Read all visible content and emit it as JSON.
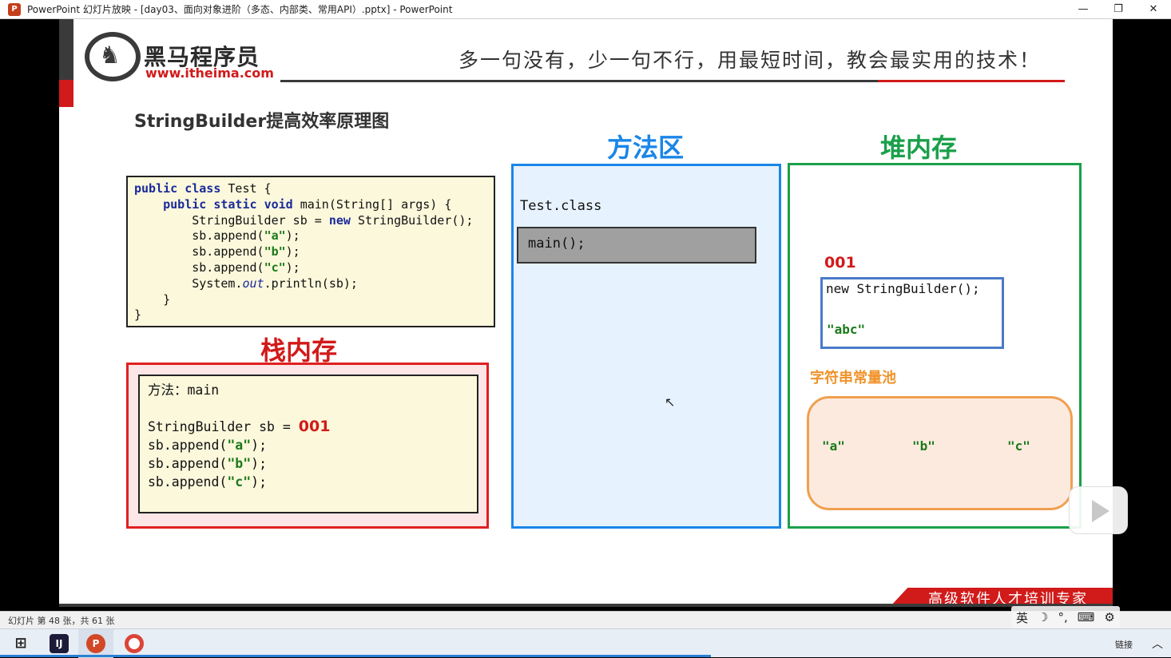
{
  "window": {
    "title": "PowerPoint 幻灯片放映 - [day03、面向对象进阶（多态、内部类、常用API）.pptx] - PowerPoint",
    "app_icon": "P",
    "minimize": "—",
    "restore": "❐",
    "close": "✕"
  },
  "header": {
    "logo_name": "黑马程序员",
    "logo_url": "www.itheima.com",
    "slogan": "多一句没有，少一句不行，用最短时间，教会最实用的技术！"
  },
  "slide": {
    "title": "StringBuilder提高效率原理图",
    "method_area_label": "方法区",
    "heap_label": "堆内存",
    "stack_label": "栈内存",
    "code": {
      "line1_kw1": "public",
      "line1_kw2": "class",
      "line1_rest": " Test {",
      "line2_kw1": "public",
      "line2_kw2": "static",
      "line2_kw3": "void",
      "line2_rest": " main(String[] args) {",
      "line3_a": "StringBuilder sb = ",
      "line3_kw": "new",
      "line3_b": " StringBuilder();",
      "line4_a": "sb.append(",
      "line4_s": "\"a\"",
      "line4_b": ");",
      "line5_a": "sb.append(",
      "line5_s": "\"b\"",
      "line5_b": ");",
      "line6_a": "sb.append(",
      "line6_s": "\"c\"",
      "line6_b": ");",
      "line7_a": "System.",
      "line7_it": "out",
      "line7_b": ".println(sb);",
      "line8": "}",
      "line9": "}"
    },
    "stack": {
      "method": "方法：main",
      "sb_decl": "StringBuilder sb = ",
      "sb_ref": "001",
      "append_prefix": "sb.append(",
      "append_suffix": ");",
      "append_a": "\"a\"",
      "append_b": "\"b\"",
      "append_c": "\"c\""
    },
    "method_area": {
      "class_name": "Test.class",
      "method": "main();"
    },
    "heap": {
      "address": "001",
      "object": "new StringBuilder();",
      "value": "\"abc\"",
      "pool_label": "字符串常量池",
      "pool_items": [
        "\"a\"",
        "\"b\"",
        "\"c\""
      ]
    },
    "footer_slogan": "高级软件人才培训专家"
  },
  "status": {
    "slide_count": "幻灯片 第 48 张，共 61 张"
  },
  "ime": {
    "lang": "英",
    "moon": "☽",
    "dot": "°,",
    "keyboard": "⌨",
    "gear": "⚙"
  },
  "taskbar": {
    "start": "⊞",
    "idea": "IJ",
    "ppt": "P",
    "tray_text": "链接",
    "tray_chevron": "︿"
  }
}
